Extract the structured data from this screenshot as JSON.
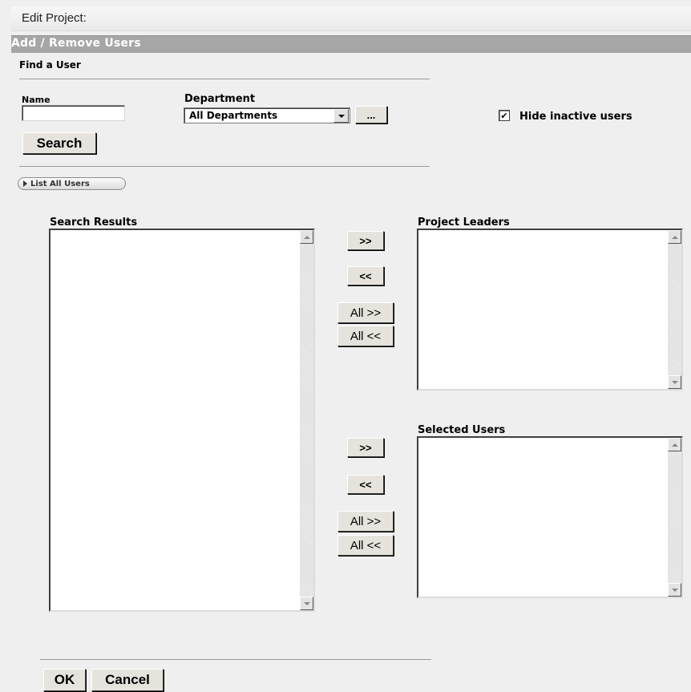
{
  "window": {
    "title": "Edit Project:"
  },
  "section": {
    "title": "Add / Remove Users"
  },
  "find": {
    "heading": "Find a User",
    "name_label": "Name",
    "name_value": "",
    "department_label": "Department",
    "department_value": "All Departments",
    "browse_label": "...",
    "search_label": "Search",
    "hide_inactive_label": "Hide inactive users",
    "hide_inactive_checked": true,
    "checkmark": "✔",
    "list_all_label": "List All Users"
  },
  "lists": {
    "search_results": "Search Results",
    "project_leaders": "Project Leaders",
    "selected_users": "Selected Users"
  },
  "transfer": {
    "add": ">>",
    "remove": "<<",
    "add_all": "All >>",
    "remove_all": "All <<"
  },
  "footer": {
    "ok": "OK",
    "cancel": "Cancel"
  }
}
